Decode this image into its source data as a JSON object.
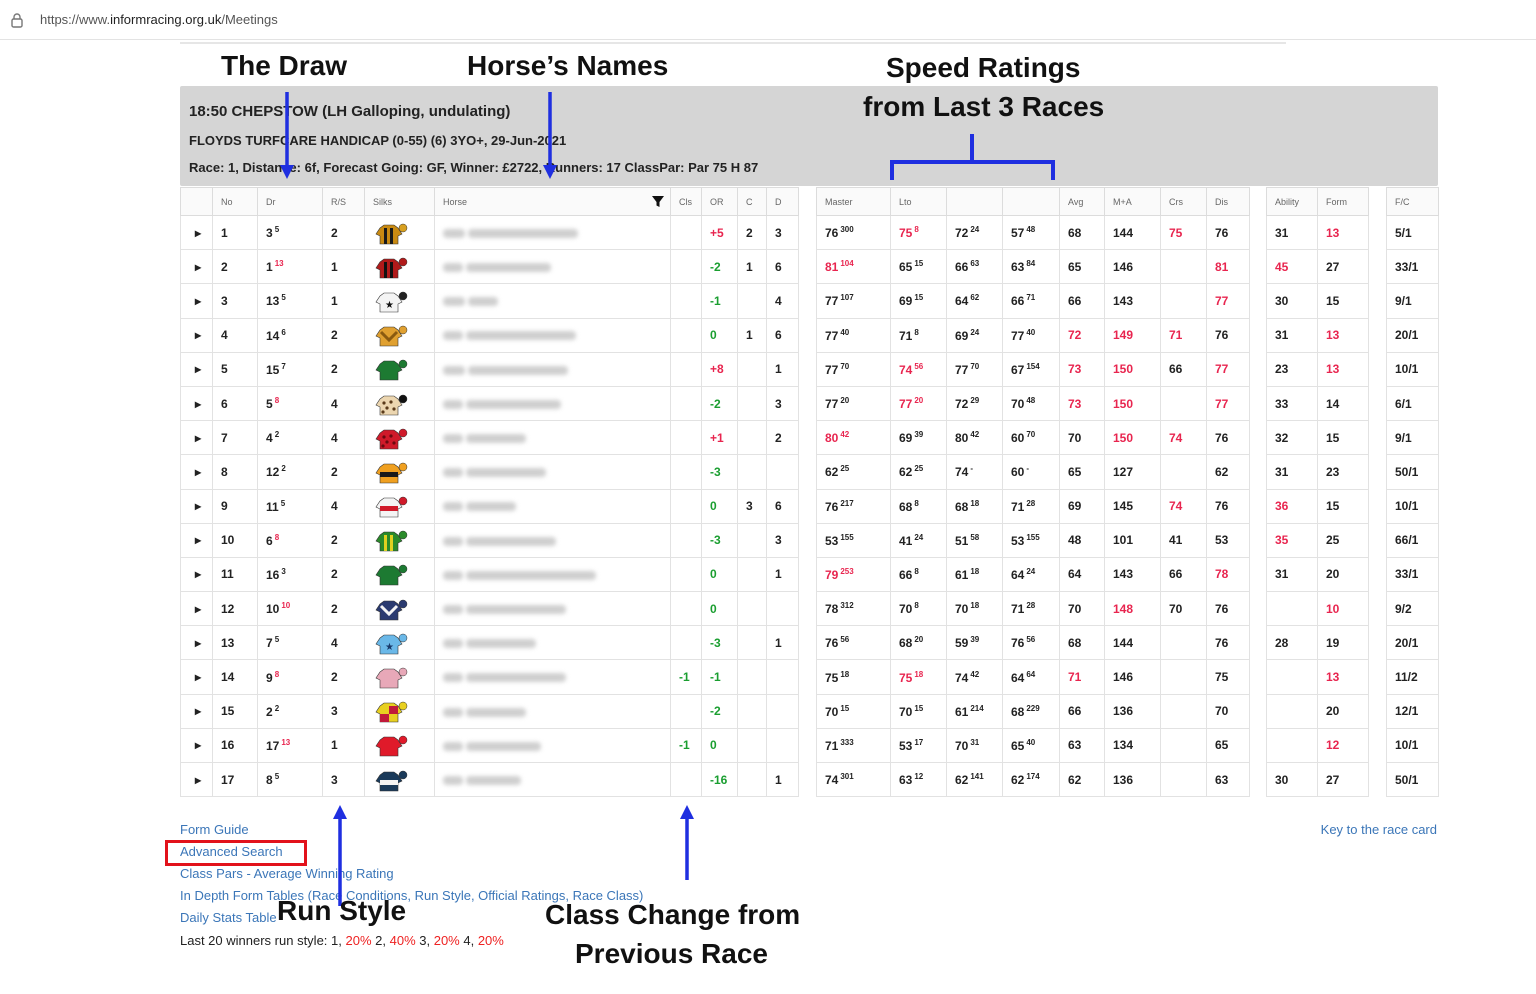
{
  "browser": {
    "url_prefix": "https://www.",
    "url_domain": "informracing.org.uk",
    "url_path": "/Meetings"
  },
  "race": {
    "title": "18:50 CHEPSTOW (LH Galloping, undulating)",
    "subtitle": "FLOYDS TURFCARE HANDICAP (0-55) (6) 3YO+, 29-Jun-2021",
    "info": "Race: 1,  Distance: 6f,  Forecast Going: GF,  Winner: £2722,  Runners: 17  ClassPar: Par 75 H 87"
  },
  "headers": {
    "main": [
      "",
      "No",
      "Dr",
      "R/S",
      "Silks",
      "Horse",
      "Cls",
      "OR",
      "C",
      "D"
    ],
    "speed": [
      "Master",
      "Lto",
      "",
      "",
      "Avg",
      "M+A",
      "Crs",
      "Dis"
    ],
    "ability": [
      "Ability",
      "Form"
    ],
    "fc": [
      "F/C"
    ]
  },
  "expand_glyph": "▸",
  "runners": [
    {
      "no": "1",
      "dr": "3",
      "drs": "5",
      "drs_red": false,
      "rs": "2",
      "silk": {
        "a": "#c98a12",
        "b": "#1a1a1a",
        "c": "#d8a020",
        "p": "stripes"
      },
      "cls": "",
      "or": "+5",
      "or_c": "red",
      "c": "2",
      "d": "3",
      "m": "76",
      "ms": "300",
      "m_red": false,
      "l": "75",
      "ls": "8",
      "l_red": true,
      "s2": "72",
      "s2s": "24",
      "s3": "57",
      "s3s": "48",
      "avg": "68",
      "avg_red": false,
      "ma": "144",
      "ma_red": false,
      "crs": "75",
      "crs_red": true,
      "dis": "76",
      "dis_red": false,
      "ab": "31",
      "ab_red": false,
      "form": "13",
      "form_red": true,
      "fc": "5/1",
      "bw": [
        22,
        110
      ]
    },
    {
      "no": "2",
      "dr": "1",
      "drs": "13",
      "drs_red": true,
      "rs": "1",
      "silk": {
        "a": "#b11a1a",
        "b": "#111111",
        "c": "#b11a1a",
        "p": "stripes"
      },
      "cls": "",
      "or": "-2",
      "or_c": "grn",
      "c": "1",
      "d": "6",
      "m": "81",
      "ms": "104",
      "m_red": true,
      "l": "65",
      "ls": "15",
      "l_red": false,
      "s2": "66",
      "s2s": "63",
      "s3": "63",
      "s3s": "84",
      "avg": "65",
      "avg_red": false,
      "ma": "146",
      "ma_red": false,
      "crs": "",
      "crs_red": false,
      "dis": "81",
      "dis_red": true,
      "ab": "45",
      "ab_red": true,
      "form": "27",
      "form_red": false,
      "fc": "33/1",
      "bw": [
        20,
        85
      ]
    },
    {
      "no": "3",
      "dr": "13",
      "drs": "5",
      "drs_red": false,
      "rs": "1",
      "silk": {
        "a": "#f4f4f4",
        "b": "#111111",
        "c": "#222222",
        "p": "star"
      },
      "cls": "",
      "or": "-1",
      "or_c": "grn",
      "c": "",
      "d": "4",
      "m": "77",
      "ms": "107",
      "m_red": false,
      "l": "69",
      "ls": "15",
      "l_red": false,
      "s2": "64",
      "s2s": "62",
      "s3": "66",
      "s3s": "71",
      "avg": "66",
      "avg_red": false,
      "ma": "143",
      "ma_red": false,
      "crs": "",
      "crs_red": false,
      "dis": "77",
      "dis_red": true,
      "ab": "30",
      "ab_red": false,
      "form": "15",
      "form_red": false,
      "fc": "9/1",
      "bw": [
        22,
        30
      ]
    },
    {
      "no": "4",
      "dr": "14",
      "drs": "6",
      "drs_red": false,
      "rs": "2",
      "silk": {
        "a": "#e0a030",
        "b": "#8a5a10",
        "c": "#e0a030",
        "p": "chev"
      },
      "cls": "",
      "or": "0",
      "or_c": "grn",
      "c": "1",
      "d": "6",
      "m": "77",
      "ms": "40",
      "m_red": false,
      "l": "71",
      "ls": "8",
      "l_red": false,
      "s2": "69",
      "s2s": "24",
      "s3": "77",
      "s3s": "40",
      "avg": "72",
      "avg_red": true,
      "ma": "149",
      "ma_red": true,
      "crs": "71",
      "crs_red": true,
      "dis": "76",
      "dis_red": false,
      "ab": "31",
      "ab_red": false,
      "form": "13",
      "form_red": true,
      "fc": "20/1",
      "bw": [
        20,
        110
      ]
    },
    {
      "no": "5",
      "dr": "15",
      "drs": "7",
      "drs_red": false,
      "rs": "2",
      "silk": {
        "a": "#1d7a32",
        "b": "#0f5a20",
        "c": "#1d7a32",
        "p": "plain"
      },
      "cls": "",
      "or": "+8",
      "or_c": "red",
      "c": "",
      "d": "1",
      "m": "77",
      "ms": "70",
      "m_red": false,
      "l": "74",
      "ls": "56",
      "l_red": true,
      "s2": "77",
      "s2s": "70",
      "s3": "67",
      "s3s": "154",
      "avg": "73",
      "avg_red": true,
      "ma": "150",
      "ma_red": true,
      "crs": "66",
      "crs_red": false,
      "dis": "77",
      "dis_red": true,
      "ab": "23",
      "ab_red": false,
      "form": "13",
      "form_red": true,
      "fc": "10/1",
      "bw": [
        22,
        100
      ]
    },
    {
      "no": "6",
      "dr": "5",
      "drs": "8",
      "drs_red": true,
      "rs": "4",
      "silk": {
        "a": "#ecd6b0",
        "b": "#5a3a1a",
        "c": "#111111",
        "p": "spots"
      },
      "cls": "",
      "or": "-2",
      "or_c": "grn",
      "c": "",
      "d": "3",
      "m": "77",
      "ms": "20",
      "m_red": false,
      "l": "77",
      "ls": "20",
      "l_red": true,
      "s2": "72",
      "s2s": "29",
      "s3": "70",
      "s3s": "48",
      "avg": "73",
      "avg_red": true,
      "ma": "150",
      "ma_red": true,
      "crs": "",
      "crs_red": false,
      "dis": "77",
      "dis_red": true,
      "ab": "33",
      "ab_red": false,
      "form": "14",
      "form_red": false,
      "fc": "6/1",
      "bw": [
        20,
        95
      ]
    },
    {
      "no": "7",
      "dr": "4",
      "drs": "2",
      "drs_red": false,
      "rs": "4",
      "silk": {
        "a": "#d01a2a",
        "b": "#6a0a10",
        "c": "#d01a2a",
        "p": "spots"
      },
      "cls": "",
      "or": "+1",
      "or_c": "red",
      "c": "",
      "d": "2",
      "m": "80",
      "ms": "42",
      "m_red": true,
      "l": "69",
      "ls": "39",
      "l_red": false,
      "s2": "80",
      "s2s": "42",
      "s3": "60",
      "s3s": "70",
      "avg": "70",
      "avg_red": false,
      "ma": "150",
      "ma_red": true,
      "crs": "74",
      "crs_red": true,
      "dis": "76",
      "dis_red": false,
      "ab": "32",
      "ab_red": false,
      "form": "15",
      "form_red": false,
      "fc": "9/1",
      "bw": [
        20,
        60
      ]
    },
    {
      "no": "8",
      "dr": "12",
      "drs": "2",
      "drs_red": false,
      "rs": "2",
      "silk": {
        "a": "#f0a020",
        "b": "#1a1a1a",
        "c": "#f0a020",
        "p": "hoop"
      },
      "cls": "",
      "or": "-3",
      "or_c": "grn",
      "c": "",
      "d": "",
      "m": "62",
      "ms": "25",
      "m_red": false,
      "l": "62",
      "ls": "25",
      "l_red": false,
      "s2": "74",
      "s2s": "-",
      "s3": "60",
      "s3s": "-",
      "avg": "65",
      "avg_red": false,
      "ma": "127",
      "ma_red": false,
      "crs": "",
      "crs_red": false,
      "dis": "62",
      "dis_red": false,
      "ab": "31",
      "ab_red": false,
      "form": "23",
      "form_red": false,
      "fc": "50/1",
      "bw": [
        20,
        80
      ]
    },
    {
      "no": "9",
      "dr": "11",
      "drs": "5",
      "drs_red": false,
      "rs": "4",
      "silk": {
        "a": "#f4f4f4",
        "b": "#d01a2a",
        "c": "#d01a2a",
        "p": "hoop"
      },
      "cls": "",
      "or": "0",
      "or_c": "grn",
      "c": "3",
      "d": "6",
      "m": "76",
      "ms": "217",
      "m_red": false,
      "l": "68",
      "ls": "8",
      "l_red": false,
      "s2": "68",
      "s2s": "18",
      "s3": "71",
      "s3s": "28",
      "avg": "69",
      "avg_red": false,
      "ma": "145",
      "ma_red": false,
      "crs": "74",
      "crs_red": true,
      "dis": "76",
      "dis_red": false,
      "ab": "36",
      "ab_red": true,
      "form": "15",
      "form_red": false,
      "fc": "10/1",
      "bw": [
        20,
        50
      ]
    },
    {
      "no": "10",
      "dr": "6",
      "drs": "8",
      "drs_red": true,
      "rs": "2",
      "silk": {
        "a": "#2a8a2a",
        "b": "#e0d020",
        "c": "#2a8a2a",
        "p": "stripes"
      },
      "cls": "",
      "or": "-3",
      "or_c": "grn",
      "c": "",
      "d": "3",
      "m": "53",
      "ms": "155",
      "m_red": false,
      "l": "41",
      "ls": "24",
      "l_red": false,
      "s2": "51",
      "s2s": "58",
      "s3": "53",
      "s3s": "155",
      "avg": "48",
      "avg_red": false,
      "ma": "101",
      "ma_red": false,
      "crs": "41",
      "crs_red": false,
      "dis": "53",
      "dis_red": false,
      "ab": "35",
      "ab_red": true,
      "form": "25",
      "form_red": false,
      "fc": "66/1",
      "bw": [
        20,
        90
      ]
    },
    {
      "no": "11",
      "dr": "16",
      "drs": "3",
      "drs_red": false,
      "rs": "2",
      "silk": {
        "a": "#1d7a32",
        "b": "#0f5a20",
        "c": "#1d7a32",
        "p": "plain"
      },
      "cls": "",
      "or": "0",
      "or_c": "grn",
      "c": "",
      "d": "1",
      "m": "79",
      "ms": "253",
      "m_red": true,
      "l": "66",
      "ls": "8",
      "l_red": false,
      "s2": "61",
      "s2s": "18",
      "s3": "64",
      "s3s": "24",
      "avg": "64",
      "avg_red": false,
      "ma": "143",
      "ma_red": false,
      "crs": "66",
      "crs_red": false,
      "dis": "78",
      "dis_red": true,
      "ab": "31",
      "ab_red": false,
      "form": "20",
      "form_red": false,
      "fc": "33/1",
      "bw": [
        20,
        130
      ]
    },
    {
      "no": "12",
      "dr": "10",
      "drs": "10",
      "drs_red": true,
      "rs": "2",
      "silk": {
        "a": "#2a3a70",
        "b": "#f4f4f4",
        "c": "#2a3a70",
        "p": "chev"
      },
      "cls": "",
      "or": "0",
      "or_c": "grn",
      "c": "",
      "d": "",
      "m": "78",
      "ms": "312",
      "m_red": false,
      "l": "70",
      "ls": "8",
      "l_red": false,
      "s2": "70",
      "s2s": "18",
      "s3": "71",
      "s3s": "28",
      "avg": "70",
      "avg_red": false,
      "ma": "148",
      "ma_red": true,
      "crs": "70",
      "crs_red": false,
      "dis": "76",
      "dis_red": false,
      "ab": "",
      "ab_red": false,
      "form": "10",
      "form_red": true,
      "fc": "9/2",
      "bw": [
        20,
        100
      ]
    },
    {
      "no": "13",
      "dr": "7",
      "drs": "5",
      "drs_red": false,
      "rs": "4",
      "silk": {
        "a": "#6ab8e8",
        "b": "#1a3a6a",
        "c": "#6ab8e8",
        "p": "star"
      },
      "cls": "",
      "or": "-3",
      "or_c": "grn",
      "c": "",
      "d": "1",
      "m": "76",
      "ms": "56",
      "m_red": false,
      "l": "68",
      "ls": "20",
      "l_red": false,
      "s2": "59",
      "s2s": "39",
      "s3": "76",
      "s3s": "56",
      "avg": "68",
      "avg_red": false,
      "ma": "144",
      "ma_red": false,
      "crs": "",
      "crs_red": false,
      "dis": "76",
      "dis_red": false,
      "ab": "28",
      "ab_red": false,
      "form": "19",
      "form_red": false,
      "fc": "20/1",
      "bw": [
        20,
        70
      ]
    },
    {
      "no": "14",
      "dr": "9",
      "drs": "8",
      "drs_red": true,
      "rs": "2",
      "silk": {
        "a": "#e8a8b8",
        "b": "#d07088",
        "c": "#e8a8b8",
        "p": "plain"
      },
      "cls": "-1",
      "or": "-1",
      "or_c": "grn",
      "c": "",
      "d": "",
      "m": "75",
      "ms": "18",
      "m_red": false,
      "l": "75",
      "ls": "18",
      "l_red": true,
      "s2": "74",
      "s2s": "42",
      "s3": "64",
      "s3s": "64",
      "avg": "71",
      "avg_red": true,
      "ma": "146",
      "ma_red": false,
      "crs": "",
      "crs_red": false,
      "dis": "75",
      "dis_red": false,
      "ab": "",
      "ab_red": false,
      "form": "13",
      "form_red": true,
      "fc": "11/2",
      "bw": [
        20,
        100
      ]
    },
    {
      "no": "15",
      "dr": "2",
      "drs": "2",
      "drs_red": false,
      "rs": "3",
      "silk": {
        "a": "#e8d020",
        "b": "#c01a3a",
        "c": "#e8d020",
        "p": "quarters"
      },
      "cls": "",
      "or": "-2",
      "or_c": "grn",
      "c": "",
      "d": "",
      "m": "70",
      "ms": "15",
      "m_red": false,
      "l": "70",
      "ls": "15",
      "l_red": false,
      "s2": "61",
      "s2s": "214",
      "s3": "68",
      "s3s": "229",
      "avg": "66",
      "avg_red": false,
      "ma": "136",
      "ma_red": false,
      "crs": "",
      "crs_red": false,
      "dis": "70",
      "dis_red": false,
      "ab": "",
      "ab_red": false,
      "form": "20",
      "form_red": false,
      "fc": "12/1",
      "bw": [
        20,
        60
      ]
    },
    {
      "no": "16",
      "dr": "17",
      "drs": "13",
      "drs_red": true,
      "rs": "1",
      "silk": {
        "a": "#e01a2a",
        "b": "#a00a1a",
        "c": "#e01a2a",
        "p": "plain"
      },
      "cls": "-1",
      "or": "0",
      "or_c": "grn",
      "c": "",
      "d": "",
      "m": "71",
      "ms": "333",
      "m_red": false,
      "l": "53",
      "ls": "17",
      "l_red": false,
      "s2": "70",
      "s2s": "31",
      "s3": "65",
      "s3s": "40",
      "avg": "63",
      "avg_red": false,
      "ma": "134",
      "ma_red": false,
      "crs": "",
      "crs_red": false,
      "dis": "65",
      "dis_red": false,
      "ab": "",
      "ab_red": false,
      "form": "12",
      "form_red": true,
      "fc": "10/1",
      "bw": [
        20,
        75
      ]
    },
    {
      "no": "17",
      "dr": "8",
      "drs": "5",
      "drs_red": false,
      "rs": "3",
      "silk": {
        "a": "#1a3a5a",
        "b": "#f4f4f4",
        "c": "#1a3a5a",
        "p": "hoop"
      },
      "cls": "",
      "or": "-16",
      "or_c": "grn",
      "c": "",
      "d": "1",
      "m": "74",
      "ms": "301",
      "m_red": false,
      "l": "63",
      "ls": "12",
      "l_red": false,
      "s2": "62",
      "s2s": "141",
      "s3": "62",
      "s3s": "174",
      "avg": "62",
      "avg_red": false,
      "ma": "136",
      "ma_red": false,
      "crs": "",
      "crs_red": false,
      "dis": "63",
      "dis_red": false,
      "ab": "30",
      "ab_red": false,
      "form": "27",
      "form_red": false,
      "fc": "50/1",
      "bw": [
        20,
        55
      ]
    }
  ],
  "links": {
    "form_guide": "Form Guide",
    "advanced_search": "Advanced Search",
    "class_pars": "Class Pars - Average Winning Rating",
    "in_depth": "In Depth Form Tables (Race Conditions, Run Style, Official Ratings, Race Class)",
    "daily_stats": "Daily Stats Table",
    "key": "Key to the race card"
  },
  "winners_style": {
    "prefix": "Last 20 winners run style: ",
    "items": [
      {
        "label": "1, ",
        "pct": "20%"
      },
      {
        "label": " 2, ",
        "pct": "40%"
      },
      {
        "label": " 3, ",
        "pct": "20%"
      },
      {
        "label": " 4, ",
        "pct": "20%"
      }
    ]
  },
  "annotations": {
    "draw": "The Draw",
    "names": "Horse’s Names",
    "speed_1": "Speed Ratings",
    "speed_2": "from Last 3 Races",
    "run_style": "Run Style",
    "class_1": "Class Change from",
    "class_2": "Previous Race"
  },
  "colors": {
    "annotation_arrow": "#1f2fe0",
    "highlight_box": "#e2121b",
    "positive_red": "#e8254f",
    "negative_green": "#1a9e30",
    "link": "#3b76b8",
    "header_bg": "#d5d5d5"
  }
}
